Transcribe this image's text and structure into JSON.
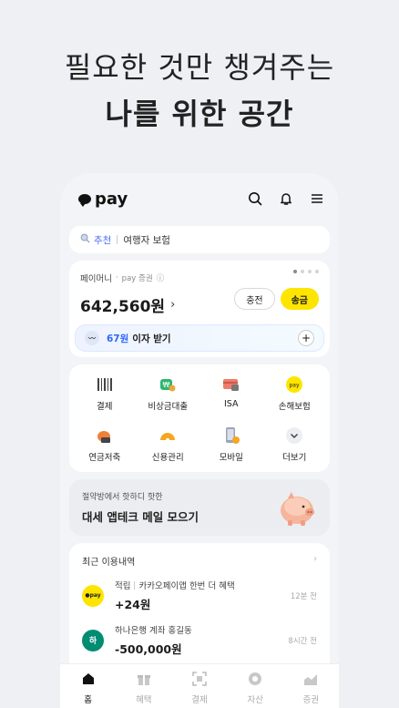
{
  "headline": {
    "line1": "필요한 것만 챙겨주는",
    "line2": "나를 위한 공간"
  },
  "app": {
    "logo_text": "pay"
  },
  "search": {
    "tag": "추천",
    "query": "여행자 보험"
  },
  "money": {
    "label": "페이머니",
    "sub_brand": "pay 증권",
    "balance": "642,560원",
    "charge_label": "충전",
    "send_label": "송금",
    "interest_amount": "67원",
    "interest_text": "이자 받기"
  },
  "services": [
    {
      "label": "결제",
      "icon": "barcode-icon"
    },
    {
      "label": "비상금대출",
      "icon": "loan-icon"
    },
    {
      "label": "ISA",
      "icon": "isa-card-icon"
    },
    {
      "label": "손해보험",
      "icon": "insurance-icon"
    },
    {
      "label": "연금저축",
      "icon": "pension-icon"
    },
    {
      "label": "신용관리",
      "icon": "credit-icon"
    },
    {
      "label": "모바일",
      "icon": "mobile-icon"
    },
    {
      "label": "더보기",
      "icon": "chevron-down-icon"
    }
  ],
  "promo": {
    "small": "절약방에서 핫하디 핫한",
    "big": "대세 앱테크 메일 모으기"
  },
  "recent": {
    "title": "최근 이용내역",
    "items": [
      {
        "category": "적립",
        "desc": "카카오페이앱 한번 더 혜택",
        "amount": "+24원",
        "time": "12분 전",
        "icon_text": "●pay"
      },
      {
        "category": "",
        "desc": "하나은행 계좌 홍길동",
        "amount": "-500,000원",
        "time": "8시간 전",
        "icon_text": "하"
      }
    ]
  },
  "tabs": [
    {
      "label": "홈",
      "icon": "home-icon",
      "active": true
    },
    {
      "label": "혜택",
      "icon": "gift-icon",
      "active": false
    },
    {
      "label": "결제",
      "icon": "scan-icon",
      "active": false
    },
    {
      "label": "자산",
      "icon": "asset-icon",
      "active": false
    },
    {
      "label": "증권",
      "icon": "stock-icon",
      "active": false
    }
  ],
  "colors": {
    "brand_yellow": "#fee500",
    "accent_blue": "#2f68ff",
    "hana_green": "#008c73"
  }
}
